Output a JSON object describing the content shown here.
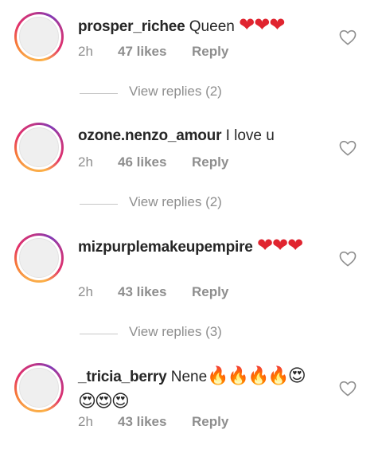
{
  "comments": [
    {
      "username": "prosper_richee",
      "text": "Queen ",
      "emoji": "❤❤❤",
      "time": "2h",
      "likes": "47 likes",
      "reply": "Reply",
      "view_replies": "View replies (2)"
    },
    {
      "username": "ozone.nenzo_amour",
      "text": "I love u",
      "emoji": "",
      "time": "2h",
      "likes": "46 likes",
      "reply": "Reply",
      "view_replies": "View replies (2)"
    },
    {
      "username": "mizpurplemakeupempire",
      "text": "",
      "emoji": "❤❤❤",
      "time": "2h",
      "likes": "43 likes",
      "reply": "Reply",
      "view_replies": "View replies (3)"
    },
    {
      "username": "_tricia_berry",
      "text": "Nene",
      "emoji": "🔥🔥🔥🔥😍😍😍😍",
      "time": "2h",
      "likes": "43 likes",
      "reply": "Reply",
      "view_replies": ""
    }
  ],
  "icons": {
    "like": "heart-outline-icon"
  },
  "colors": {
    "username": "#262626",
    "meta": "#8e8e8e",
    "heart": "#e0242f"
  }
}
